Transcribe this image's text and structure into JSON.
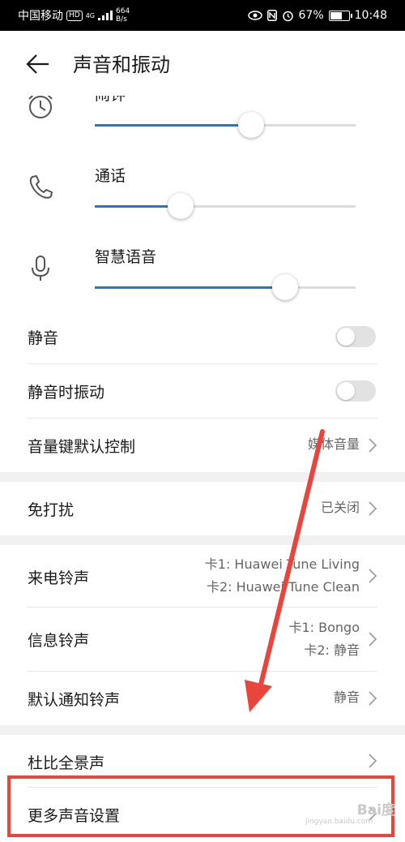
{
  "status_bar": {
    "carrier": "中国移动",
    "hd_badge": "HD",
    "network": "4G",
    "net_speed_value": "664",
    "net_speed_unit": "B/s",
    "battery_percent": "67%",
    "battery_level": 0.67,
    "time": "10:48"
  },
  "header": {
    "title": "声音和振动"
  },
  "volume_sliders": [
    {
      "label": "闹钟",
      "icon": "alarm-clock-icon",
      "level": 0.6
    },
    {
      "label": "通话",
      "icon": "phone-icon",
      "level": 0.33
    },
    {
      "label": "智慧语音",
      "icon": "microphone-icon",
      "level": 0.73
    }
  ],
  "toggles": [
    {
      "label": "静音",
      "on": false
    },
    {
      "label": "静音时振动",
      "on": false
    }
  ],
  "volume_key": {
    "label": "音量键默认控制",
    "value": "媒体音量"
  },
  "dnd": {
    "label": "免打扰",
    "value": "已关闭"
  },
  "ringtone": {
    "label": "来电铃声",
    "value_line1": "卡1: Huawei Tune Living",
    "value_line2": "卡2: Huawei Tune Clean"
  },
  "message_tone": {
    "label": "信息铃声",
    "value_line1": "卡1: Bongo",
    "value_line2": "卡2: 静音"
  },
  "notification_tone": {
    "label": "默认通知铃声",
    "value": "静音"
  },
  "dolby": {
    "label": "杜比全景声"
  },
  "more_settings": {
    "label": "更多声音设置"
  },
  "watermark": {
    "text": "Bai度",
    "sub": "jingyan.baidu.com"
  },
  "colors": {
    "accent": "#1a7ad6",
    "annotation": "#e8453c"
  }
}
